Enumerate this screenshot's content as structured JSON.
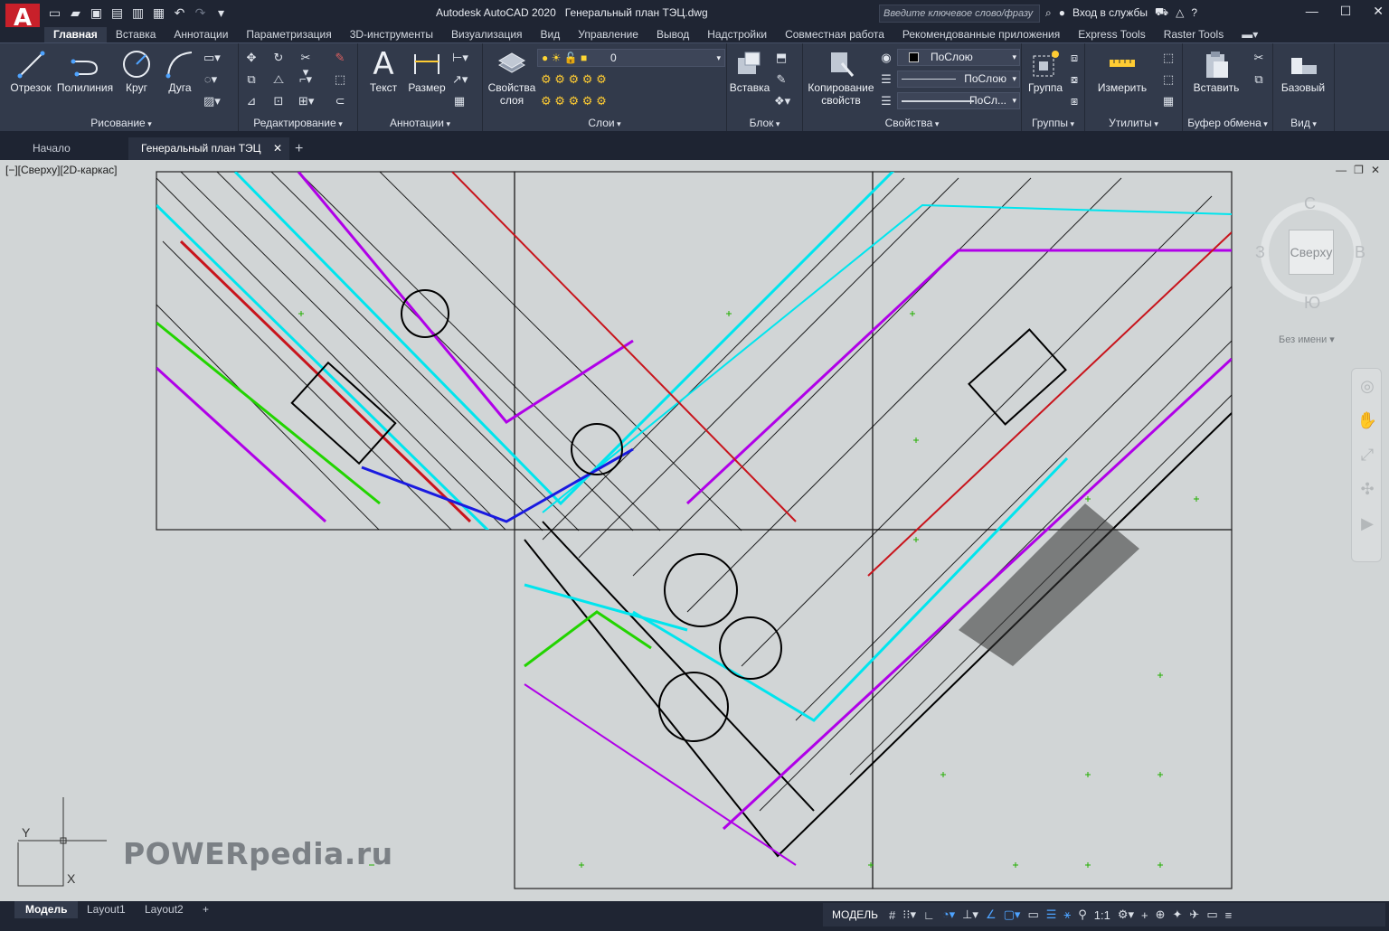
{
  "titlebar": {
    "logo_letter": "A",
    "title": "Autodesk AutoCAD 2020   Генеральный план ТЭЦ.dwg",
    "search_placeholder": "Введите ключевое слово/фразу",
    "signin": "Вход в службы"
  },
  "ribbon_tabs": [
    "Главная",
    "Вставка",
    "Аннотации",
    "Параметризация",
    "3D-инструменты",
    "Визуализация",
    "Вид",
    "Управление",
    "Вывод",
    "Надстройки",
    "Совместная работа",
    "Рекомендованные приложения",
    "Express Tools",
    "Raster Tools"
  ],
  "ribbon": {
    "draw": {
      "title": "Рисование",
      "line": "Отрезок",
      "polyline": "Полилиния",
      "circle": "Круг",
      "arc": "Дуга"
    },
    "modify": {
      "title": "Редактирование"
    },
    "annotation": {
      "title": "Аннотации",
      "text": "Текст",
      "dimension": "Размер"
    },
    "layers": {
      "title": "Слои",
      "layer_props_1": "Свойства",
      "layer_props_2": "слоя",
      "current_layer": "0"
    },
    "block": {
      "title": "Блок",
      "insert": "Вставка"
    },
    "properties": {
      "title": "Свойства",
      "match_1": "Копирование",
      "match_2": "свойств",
      "color": "ПоСлою",
      "linetype": "ПоСлою",
      "lineweight": "ПоСл..."
    },
    "groups": {
      "title": "Группы",
      "group": "Группа"
    },
    "utilities": {
      "title": "Утилиты",
      "measure": "Измерить"
    },
    "clipboard": {
      "title": "Буфер обмена",
      "paste": "Вставить"
    },
    "view": {
      "title": "Вид",
      "base": "Базовый"
    }
  },
  "file_tabs": {
    "start": "Начало",
    "drawing": "Генеральный план ТЭЦ"
  },
  "viewport": {
    "label": "[−][Сверху][2D-каркас]",
    "viewcube": {
      "face": "Сверху",
      "north": "С",
      "south": "Ю",
      "west": "З",
      "east": "В",
      "ucs": "Без имени"
    },
    "ucs_x": "X",
    "ucs_y": "Y",
    "watermark": "POWERpedia.ru"
  },
  "layout_tabs": [
    "Модель",
    "Layout1",
    "Layout2"
  ],
  "status": {
    "model": "МОДЕЛЬ",
    "scale": "1:1"
  },
  "colors": {
    "cyan": "#00e5ee",
    "magenta": "#b000e8",
    "red": "#c8141c",
    "green": "#22d400",
    "blue": "#1a1ae0",
    "black": "#000000",
    "paper": "#d1d5d6"
  }
}
